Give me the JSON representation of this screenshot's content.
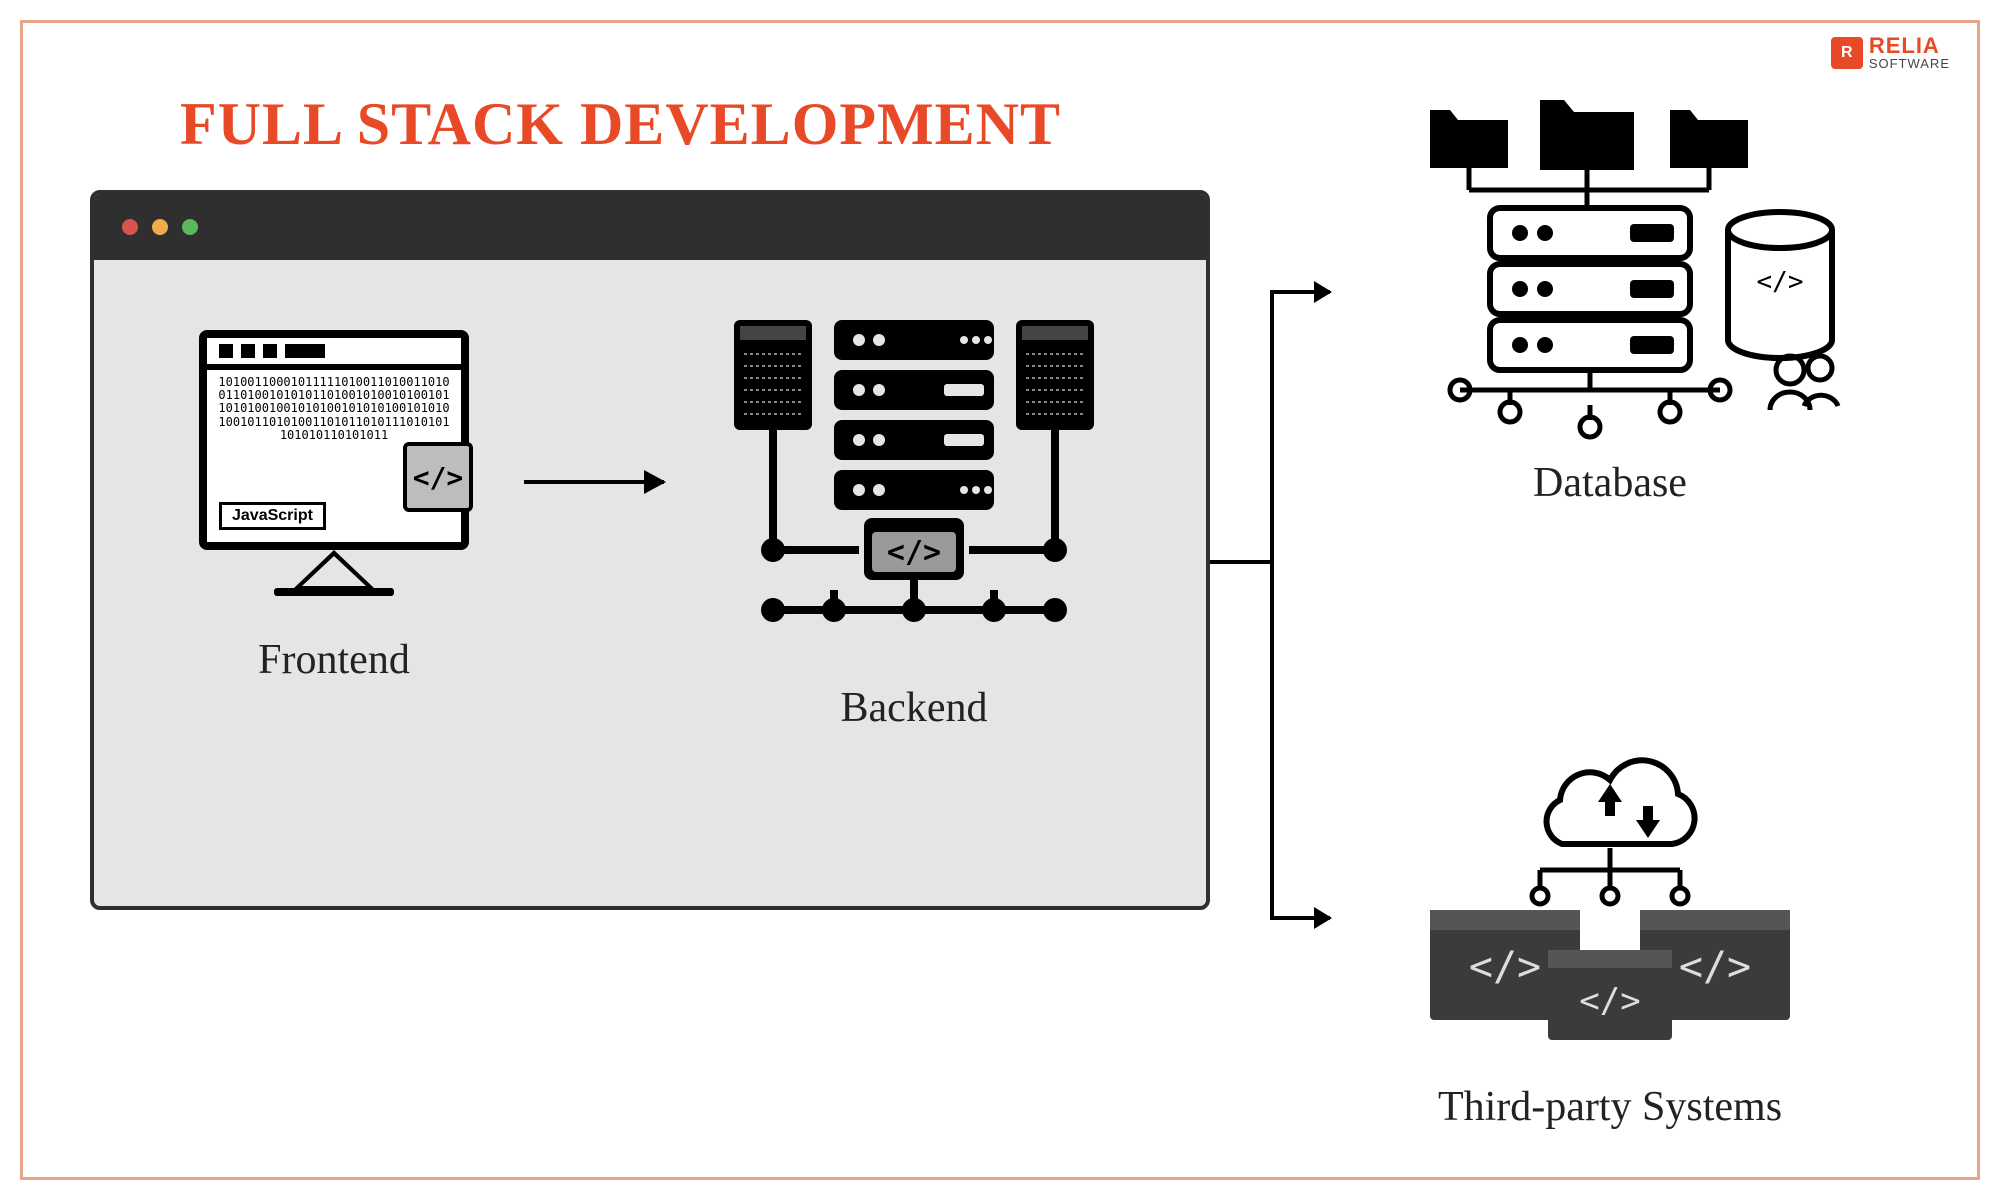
{
  "title": "FULL STACK DEVELOPMENT",
  "logo": {
    "brand": "RELIA",
    "sub": "SOFTWARE"
  },
  "sections": {
    "frontend": {
      "label": "Frontend",
      "javascript_badge": "JavaScript",
      "code_symbol": "</>",
      "binary_text": "10100110001011111010011010011010011010010101011010010100101001011010100100101010010101010010101010010110101001101011010111010101101010110101011"
    },
    "backend": {
      "label": "Backend",
      "code_symbol": "</>"
    },
    "database": {
      "label": "Database"
    },
    "thirdparty": {
      "label": "Third-party Systems"
    }
  },
  "colors": {
    "accent": "#e84a27",
    "frame": "#e8a48a",
    "dark": "#2f2f2f",
    "window_bg": "#e5e5e5"
  }
}
